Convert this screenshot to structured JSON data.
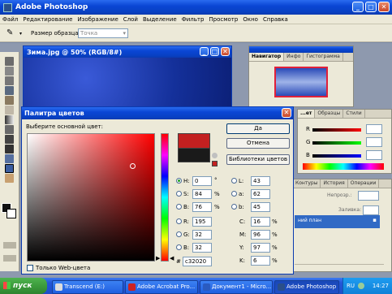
{
  "app": {
    "title": "Adobe Photoshop"
  },
  "menu": [
    "Файл",
    "Редактирование",
    "Изображение",
    "Слой",
    "Выделение",
    "Фильтр",
    "Просмотр",
    "Окно",
    "Справка"
  ],
  "options": {
    "sample_label": "Размер образца:",
    "sample_value": "Точка"
  },
  "document": {
    "title": "Зима.jpg @ 50% (RGB/8#)"
  },
  "navigator": {
    "tabs": [
      "Навигатор",
      "Инфо",
      "Гистограмма"
    ]
  },
  "color_panel": {
    "tabs": [
      "...ет",
      "Образцы",
      "Стили"
    ],
    "labels": [
      "R",
      "G",
      "B"
    ]
  },
  "layers_panel": {
    "tabs": [
      "Контуры",
      "История",
      "Операции"
    ],
    "opacity_label": "Непрозр.:",
    "fill_label": "Заливка:",
    "layer_name": "ний план"
  },
  "picker": {
    "title": "Палитра цветов",
    "prompt": "Выберите основной цвет:",
    "buttons": {
      "ok": "Да",
      "cancel": "Отмена",
      "libraries": "Библиотеки цветов"
    },
    "fields": {
      "H": {
        "label": "H:",
        "value": "0",
        "unit": "°"
      },
      "S": {
        "label": "S:",
        "value": "84",
        "unit": "%"
      },
      "B": {
        "label": "B:",
        "value": "76",
        "unit": "%"
      },
      "R": {
        "label": "R:",
        "value": "195"
      },
      "G": {
        "label": "G:",
        "value": "32"
      },
      "Bl": {
        "label": "B:",
        "value": "32"
      },
      "L": {
        "label": "L:",
        "value": "43"
      },
      "a": {
        "label": "a:",
        "value": "62"
      },
      "b": {
        "label": "b:",
        "value": "45"
      },
      "C": {
        "label": "C:",
        "value": "16",
        "unit": "%"
      },
      "M": {
        "label": "M:",
        "value": "96",
        "unit": "%"
      },
      "Y": {
        "label": "Y:",
        "value": "97",
        "unit": "%"
      },
      "K": {
        "label": "K:",
        "value": "6",
        "unit": "%"
      },
      "hex": {
        "label": "#",
        "value": "c32020"
      }
    },
    "web_only": "Только Web-цвета",
    "new_color": "#c32020",
    "old_color": "#1a1a1a"
  },
  "taskbar": {
    "start": "пуск",
    "items": [
      "Transcend (E:)",
      "Adobe Acrobat Pro...",
      "Документ1 - Micro...",
      "Adobe Photoshop"
    ],
    "lang": "RU",
    "clock": "14:27"
  },
  "colors": {
    "xp_blue": "#0a46d4",
    "taskbar": "#2456d8",
    "start_green": "#3c9b3c",
    "accent_red": "#c32020"
  }
}
